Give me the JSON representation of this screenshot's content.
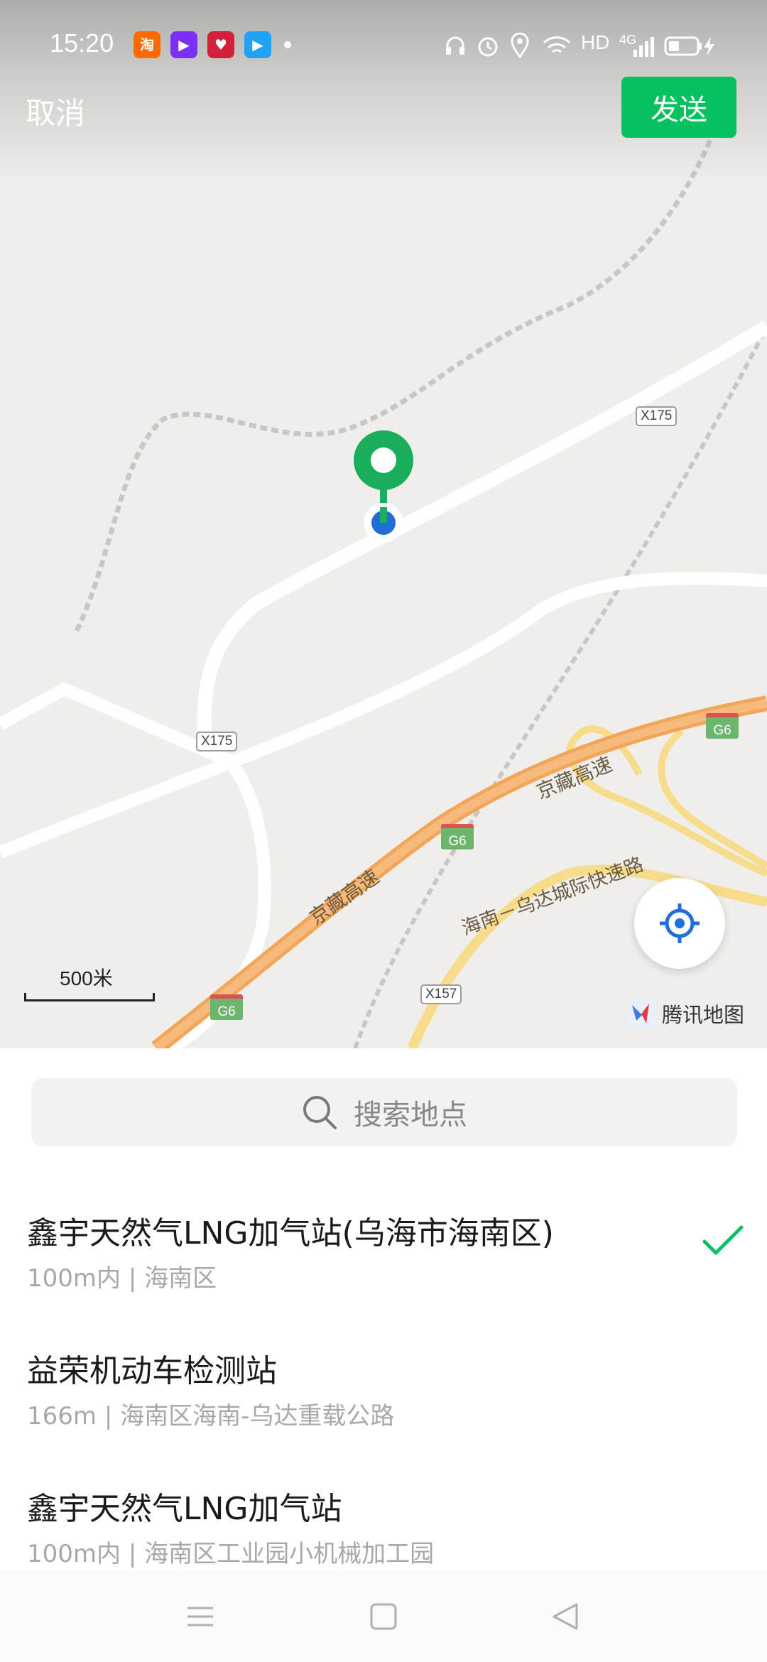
{
  "status_bar": {
    "time": "15:20",
    "apps": [
      {
        "name": "taobao-icon",
        "text": "淘",
        "color": "#ff6a00"
      },
      {
        "name": "video-app-icon",
        "text": "▶",
        "color": "#7b2ff7"
      },
      {
        "name": "shopping-app-icon",
        "text": "♥",
        "color": "#d4213b"
      },
      {
        "name": "tencent-video-icon",
        "text": "▶",
        "color": "#21a2f2"
      }
    ],
    "network": "HD",
    "signal": "4G"
  },
  "header": {
    "cancel_label": "取消",
    "send_label": "发送"
  },
  "map": {
    "road_tags": [
      "X175",
      "X175",
      "X157"
    ],
    "expressway_tags": [
      "G6",
      "G6",
      "G6"
    ],
    "road_names": [
      "京藏高速",
      "京藏高速",
      "海南－乌达城际快速路"
    ],
    "scale": "500米",
    "brand": "腾讯地图"
  },
  "search": {
    "placeholder": "搜索地点"
  },
  "places": [
    {
      "name": "鑫宇天然气LNG加气站(乌海市海南区)",
      "sub": "100m内 | 海南区",
      "selected": true
    },
    {
      "name": "益荣机动车检测站",
      "sub": "166m | 海南区海南-乌达重载公路",
      "selected": false
    },
    {
      "name": "鑫宇天然气LNG加气站",
      "sub": "100m内 | 海南区工业园小机械加工园",
      "selected": false
    }
  ],
  "colors": {
    "accent": "#07c160",
    "pin": "#1aad5b",
    "location_dot": "#1e6fd9"
  }
}
